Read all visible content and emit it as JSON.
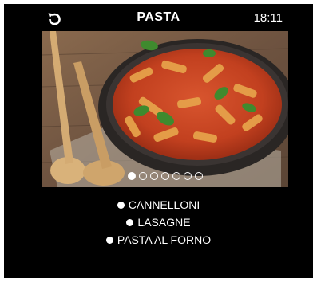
{
  "header": {
    "title": "PASTA",
    "time": "18:11",
    "back_icon": "back-refresh-icon"
  },
  "carousel": {
    "image_label": "baked pasta dish",
    "pages": 7,
    "active_page": 1
  },
  "menu": {
    "items": [
      {
        "label": "CANNELLONI"
      },
      {
        "label": "LASAGNE"
      },
      {
        "label": "PASTA AL FORNO"
      }
    ]
  },
  "colors": {
    "screen_bg": "#000000",
    "text": "#ffffff",
    "frame": "#ffffff"
  }
}
